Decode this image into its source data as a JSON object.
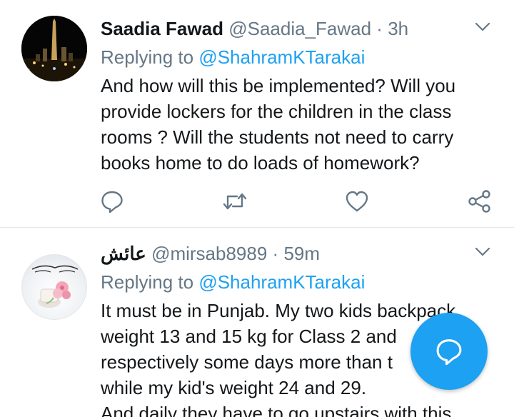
{
  "tweets": [
    {
      "author": "Saadia Fawad",
      "handle": "@Saadia_Fawad",
      "sep": "·",
      "time": "3h",
      "replying_prefix": "Replying to",
      "replying_handle": "@ShahramKTarakai",
      "lines": [
        "And how will this be implemented? Will you",
        "provide lockers for the children in the class",
        "rooms ? Will the students not need to carry",
        "books home to do loads of homework?"
      ]
    },
    {
      "author": "عائش",
      "handle": "@mirsab8989",
      "sep": "·",
      "time": "59m",
      "replying_prefix": "Replying to",
      "replying_handle": "@ShahramKTarakai",
      "lines": [
        "It must be in Punjab. My two kids backpack",
        "weight  13 and 15 kg for Class 2 and",
        "respectively some days more than t",
        "while my kid's weight 24 and 29.",
        "And daily they have to go upstairs with this"
      ]
    }
  ],
  "icons": {
    "caret": "chevron-down-icon",
    "reply": "reply-icon",
    "retweet": "retweet-icon",
    "like": "heart-icon",
    "share": "share-icon",
    "compose": "compose-reply-icon"
  },
  "colors": {
    "accent": "#1da1f2",
    "muted": "#657786",
    "text": "#14171a",
    "divider": "#e1e8ed"
  }
}
